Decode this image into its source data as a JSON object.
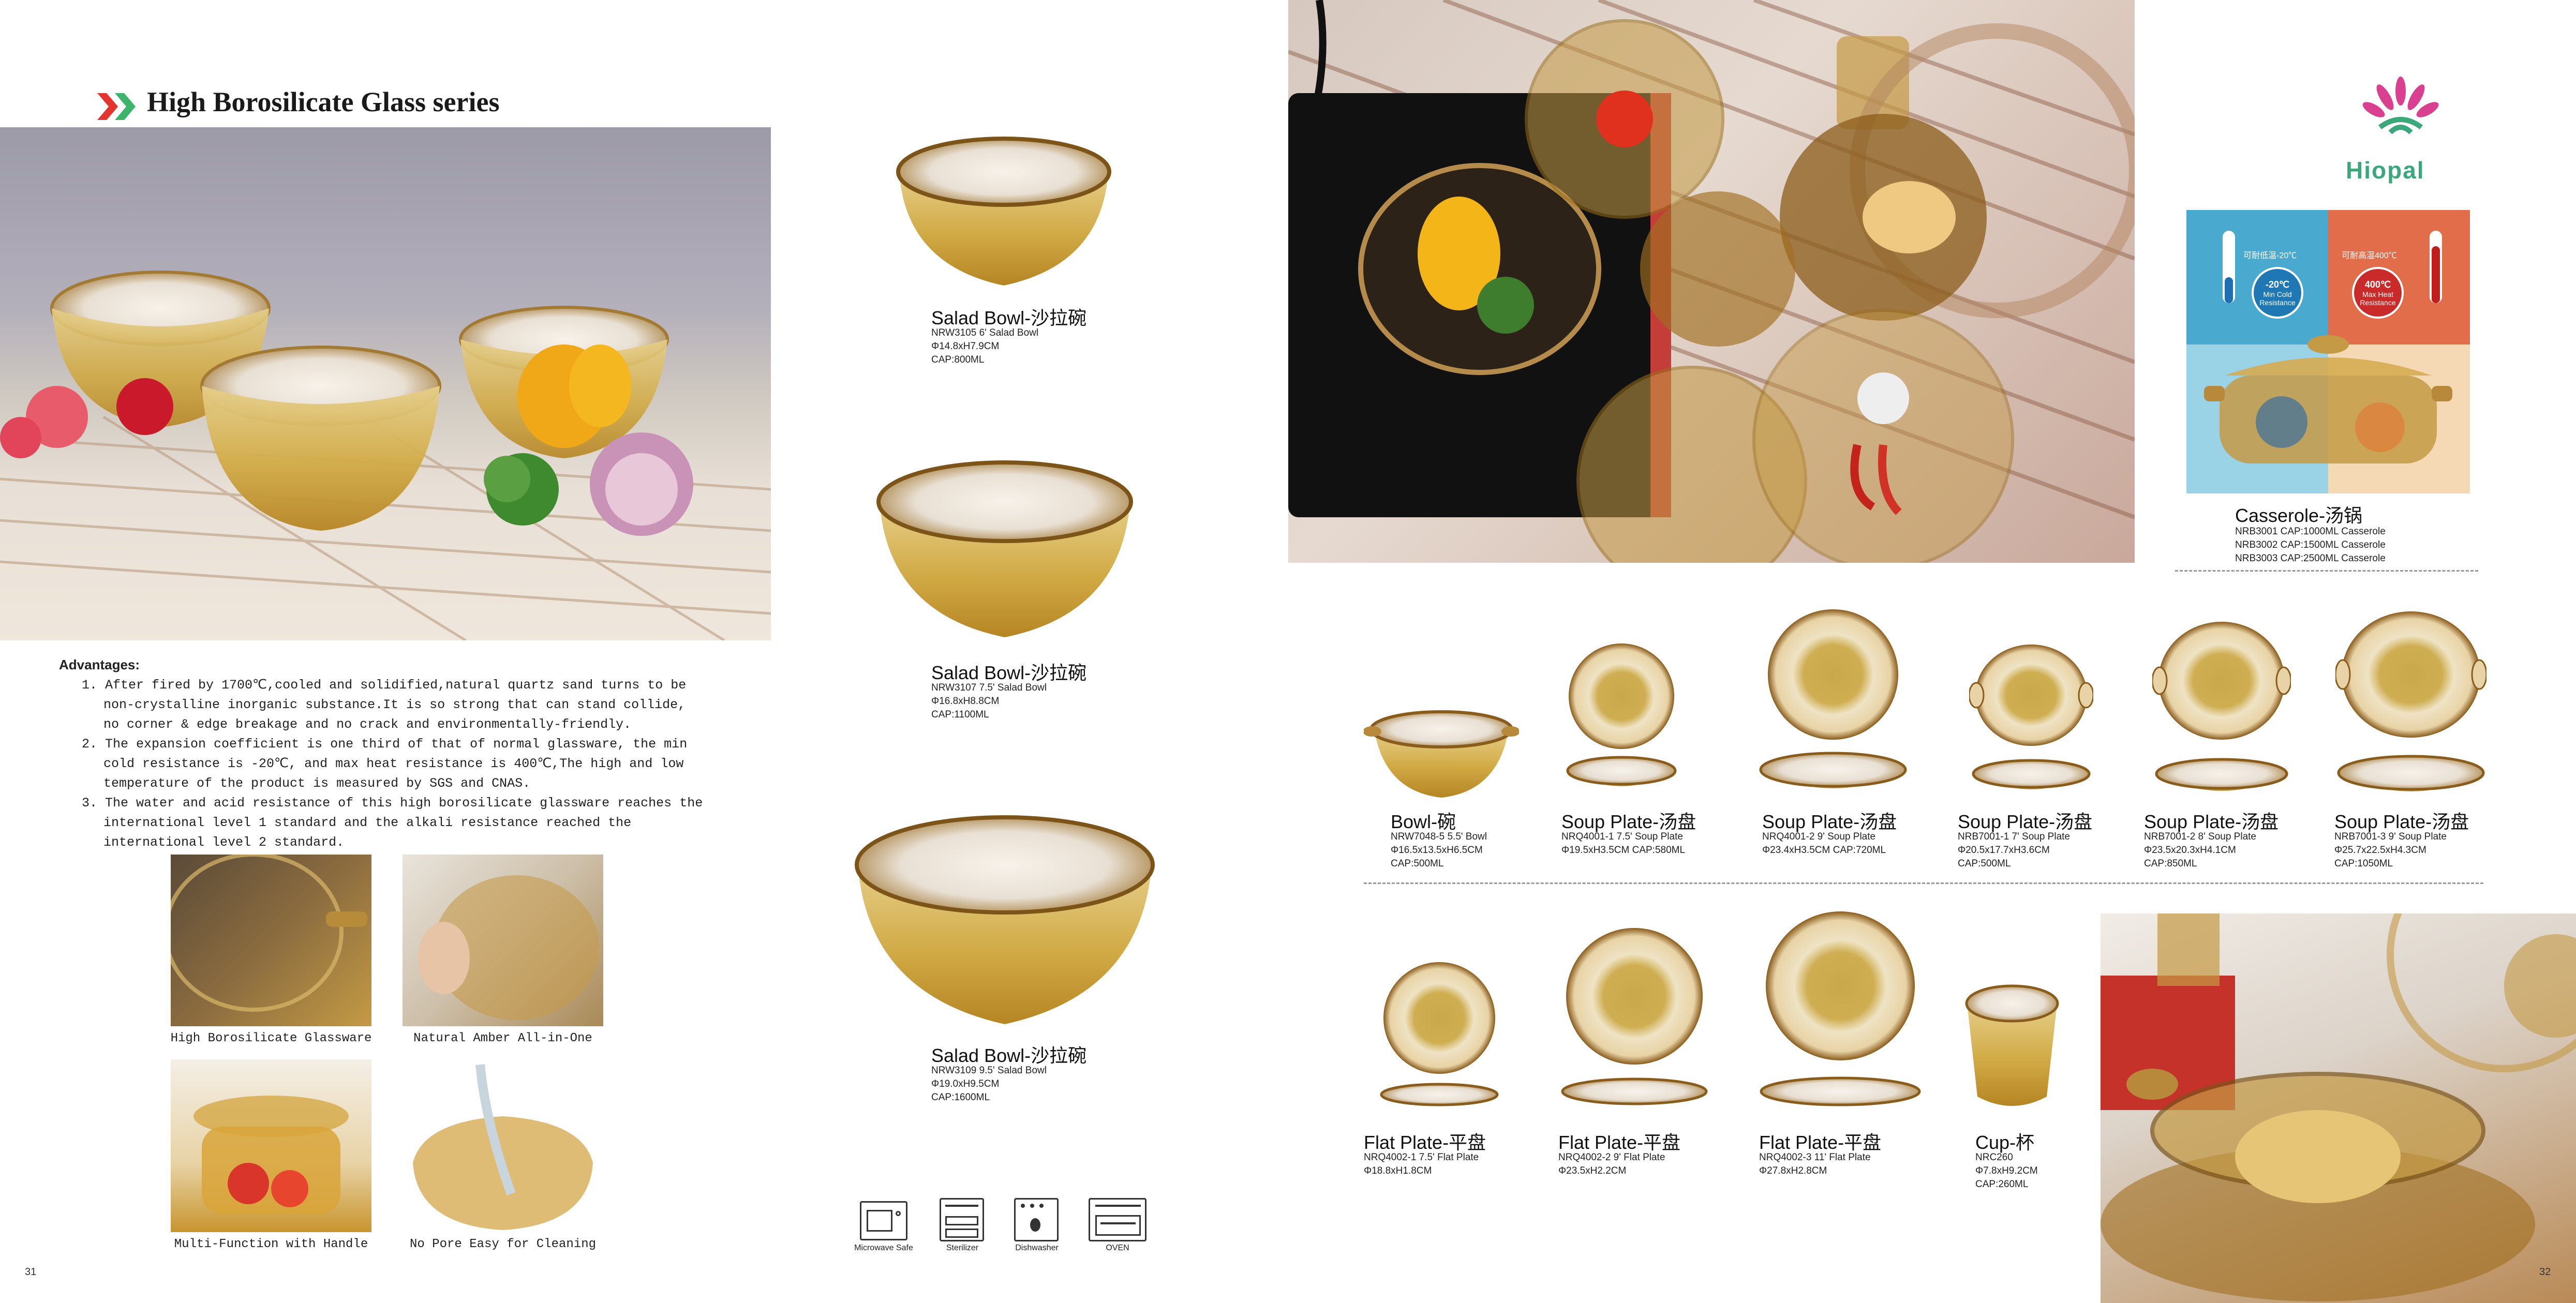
{
  "left_page": {
    "title": "High Borosilicate Glass series",
    "advantages_heading": "Advantages:",
    "advantages": [
      "1. After fired by 1700℃,cooled and solidified,natural quartz sand turns to be non-crystalline inorganic substance.It is so strong that can stand collide, no corner & edge breakage and no crack and environmentally-friendly.",
      "2. The expansion coefficient is one third of that  of normal glassware, the min cold resistance is -20℃, and max heat resistance is 400℃,The high and low temperature of the product is measured by SGS and CNAS.",
      "3. The water and acid resistance of this high borosilicate glassware reaches the international level 1 standard  and the alkali resistance reached the international level 2 standard."
    ],
    "feature_photos": [
      {
        "caption": "High Borosilicate Glassware"
      },
      {
        "caption": "Natural Amber All-in-One"
      },
      {
        "caption": "Multi-Function with Handle"
      },
      {
        "caption": "No Pore Easy for Cleaning"
      }
    ],
    "page_number": "31"
  },
  "salad_bowls": [
    {
      "name": "Salad Bowl-沙拉碗",
      "code": "NRW3105   6' Salad Bowl",
      "size": "Φ14.8xH7.9CM",
      "cap": "CAP:800ML"
    },
    {
      "name": "Salad Bowl-沙拉碗",
      "code": "NRW3107   7.5' Salad Bowl",
      "size": "Φ16.8xH8.8CM",
      "cap": "CAP:1100ML"
    },
    {
      "name": "Salad Bowl-沙拉碗",
      "code": "NRW3109   9.5' Salad Bowl",
      "size": "Φ19.0xH9.5CM",
      "cap": "CAP:1600ML"
    }
  ],
  "usage_icons": [
    {
      "label": "Microwave Safe",
      "icon": "microwave-icon"
    },
    {
      "label": "Sterilizer",
      "icon": "sterilizer-icon"
    },
    {
      "label": "Dishwasher",
      "icon": "dishwasher-icon"
    },
    {
      "label": "OVEN",
      "icon": "oven-icon"
    }
  ],
  "right_page": {
    "brand": "Hiopal",
    "casserole_banner": {
      "cold_label": "可耐低温-20℃",
      "hot_label": "可耐高温400℃",
      "cold_value": "-20℃",
      "cold_text": "Min Cold Resistance",
      "hot_value": "400℃",
      "hot_text": "Max Heat Resistance"
    },
    "casserole": {
      "name": "Casserole-汤锅",
      "lines": [
        "NRB3001   CAP:1000ML Casserole",
        "NRB3002   CAP:1500ML Casserole",
        "NRB3003   CAP:2500ML Casserole"
      ]
    },
    "row1": [
      {
        "name": "Bowl-碗",
        "l1": "NRW7048-5   5.5' Bowl",
        "l2": "Φ16.5x13.5xH6.5CM",
        "l3": "CAP:500ML"
      },
      {
        "name": "Soup Plate-汤盘",
        "l1": "NRQ4001-1   7.5' Soup Plate",
        "l2": "Φ19.5xH3.5CM    CAP:580ML",
        "l3": ""
      },
      {
        "name": "Soup Plate-汤盘",
        "l1": "NRQ4001-2   9' Soup Plate",
        "l2": "Φ23.4xH3.5CM    CAP:720ML",
        "l3": ""
      },
      {
        "name": "Soup Plate-汤盘",
        "l1": "NRB7001-1   7' Soup Plate",
        "l2": "Φ20.5x17.7xH3.6CM",
        "l3": "CAP:500ML"
      },
      {
        "name": "Soup Plate-汤盘",
        "l1": "NRB7001-2   8' Soup Plate",
        "l2": "Φ23.5x20.3xH4.1CM",
        "l3": "CAP:850ML"
      },
      {
        "name": "Soup Plate-汤盘",
        "l1": "NRB7001-3   9' Soup Plate",
        "l2": "Φ25.7x22.5xH4.3CM",
        "l3": "CAP:1050ML"
      }
    ],
    "row2": [
      {
        "name": "Flat Plate-平盘",
        "l1": "NRQ4002-1   7.5' Flat Plate",
        "l2": "Φ18.8xH1.8CM",
        "l3": ""
      },
      {
        "name": "Flat Plate-平盘",
        "l1": "NRQ4002-2   9' Flat Plate",
        "l2": "Φ23.5xH2.2CM",
        "l3": ""
      },
      {
        "name": "Flat Plate-平盘",
        "l1": "NRQ4002-3   11' Flat Plate",
        "l2": "Φ27.8xH2.8CM",
        "l3": ""
      },
      {
        "name": "Cup-杯",
        "l1": "NRC260",
        "l2": "Φ7.8xH9.2CM",
        "l3": "CAP:260ML"
      }
    ],
    "page_number": "32"
  }
}
